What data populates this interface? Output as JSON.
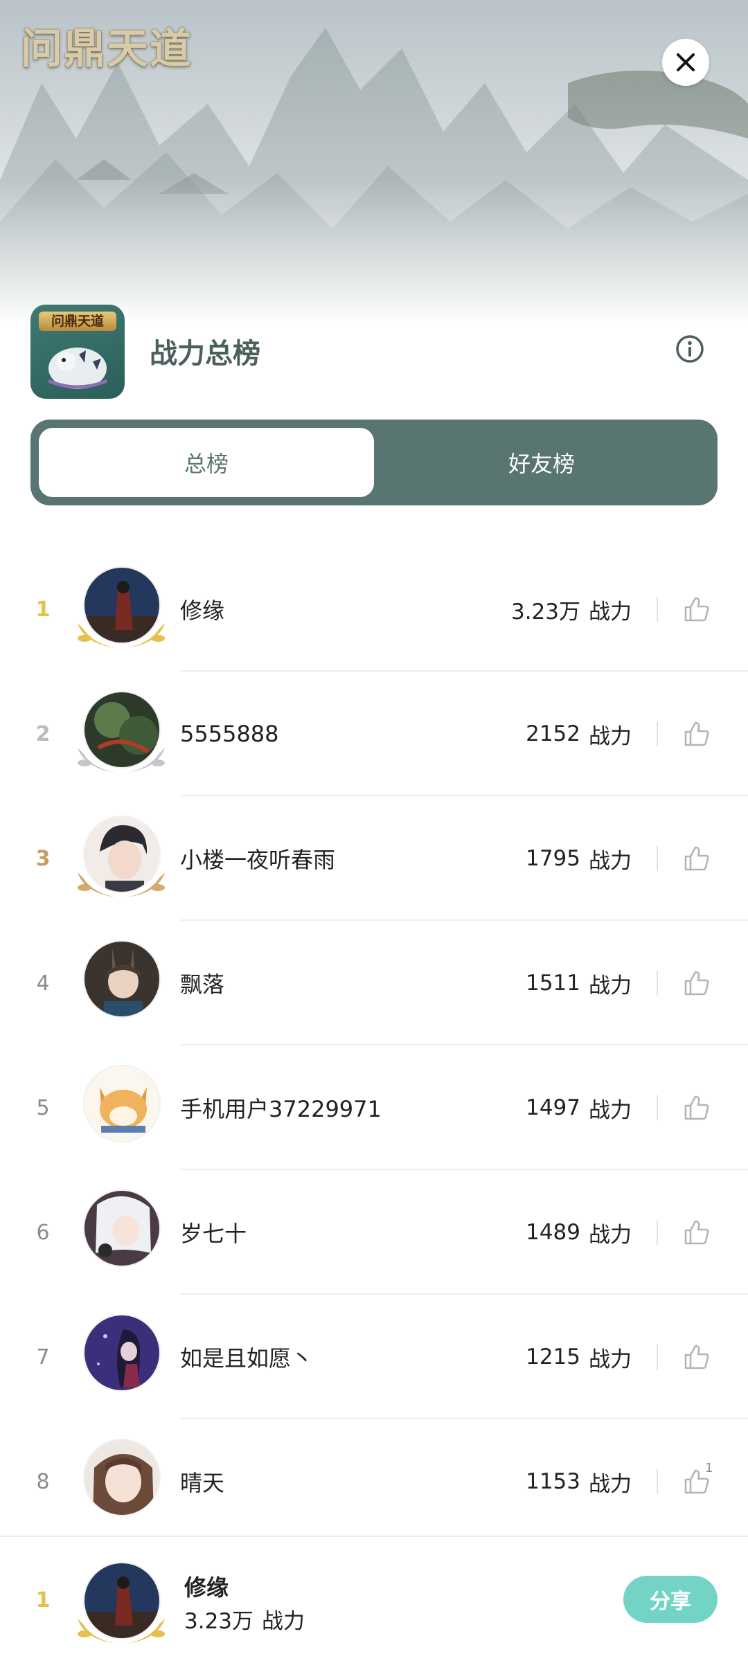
{
  "banner": {
    "logo_text": "问鼎天道"
  },
  "header": {
    "app_icon_title": "问鼎天道",
    "title": "战力总榜"
  },
  "tabs": [
    {
      "label": "总榜",
      "active": true
    },
    {
      "label": "好友榜",
      "active": false
    }
  ],
  "ranking": [
    {
      "rank": "1",
      "name": "修缘",
      "score": "3.23万",
      "unit": "战力",
      "likes": ""
    },
    {
      "rank": "2",
      "name": "5555888",
      "score": "2152",
      "unit": "战力",
      "likes": ""
    },
    {
      "rank": "3",
      "name": "小楼一夜听春雨",
      "score": "1795",
      "unit": "战力",
      "likes": ""
    },
    {
      "rank": "4",
      "name": "飘落",
      "score": "1511",
      "unit": "战力",
      "likes": ""
    },
    {
      "rank": "5",
      "name": "手机用户37229971",
      "score": "1497",
      "unit": "战力",
      "likes": ""
    },
    {
      "rank": "6",
      "name": "岁七十",
      "score": "1489",
      "unit": "战力",
      "likes": ""
    },
    {
      "rank": "7",
      "name": "如是且如愿丶",
      "score": "1215",
      "unit": "战力",
      "likes": ""
    },
    {
      "rank": "8",
      "name": "晴天",
      "score": "1153",
      "unit": "战力",
      "likes": "1"
    }
  ],
  "my_rank": {
    "rank": "1",
    "name": "修缘",
    "score": "3.23万",
    "unit": "战力",
    "share_label": "分享"
  },
  "colors": {
    "tab_bar": "#587572",
    "share_button": "#73d4c5",
    "gold": "#e5c04a",
    "silver": "#b8bcbf",
    "bronze": "#c99a63"
  }
}
